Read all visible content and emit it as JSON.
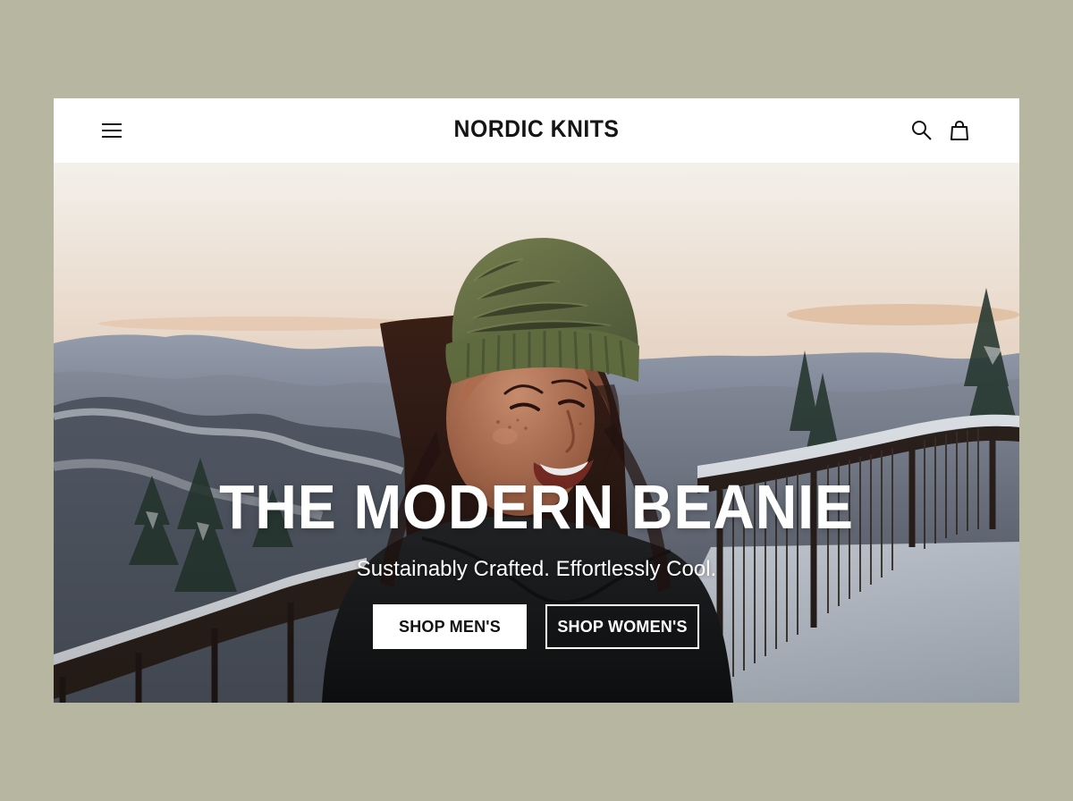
{
  "brand": {
    "name": "NORDIC KNITS"
  },
  "header": {
    "menu_icon": "menu-icon",
    "search_icon": "search-icon",
    "bag_icon": "shopping-bag-icon"
  },
  "hero": {
    "title": "THE MODERN BEANIE",
    "subtitle": "Sustainably Crafted. Effortlessly Cool.",
    "buttons": [
      {
        "label": "SHOP MEN'S"
      },
      {
        "label": "SHOP WOMEN'S"
      }
    ]
  },
  "colors": {
    "page_background": "#b7b6a0",
    "header_background": "#ffffff",
    "brand_text": "#151515",
    "beanie_green": "#657147",
    "cta_primary_background": "#ffffff",
    "cta_secondary_border": "#ffffff"
  }
}
